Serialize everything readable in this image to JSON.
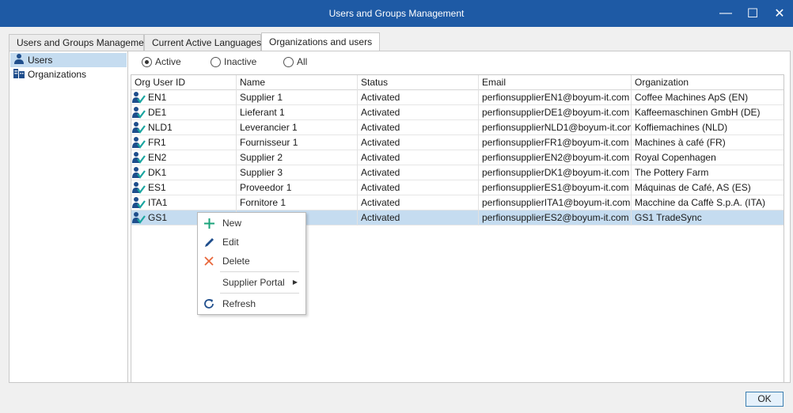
{
  "window": {
    "title": "Users and Groups Management",
    "controls": {
      "minimize": "—",
      "maximize": "☐",
      "close": "✕"
    }
  },
  "tabs": [
    {
      "label": "Users and Groups Management"
    },
    {
      "label": "Current Active Languages"
    },
    {
      "label": "Organizations and users",
      "active": true
    }
  ],
  "sidebar": {
    "items": [
      {
        "label": "Users",
        "icon": "users-icon",
        "selected": true
      },
      {
        "label": "Organizations",
        "icon": "organizations-icon"
      }
    ]
  },
  "filter": {
    "options": [
      {
        "label": "Active",
        "checked": true
      },
      {
        "label": "Inactive",
        "checked": false
      },
      {
        "label": "All",
        "checked": false
      }
    ]
  },
  "grid": {
    "columns": [
      "Org User ID",
      "Name",
      "Status",
      "Email",
      "Organization"
    ],
    "rows": [
      {
        "id": "EN1",
        "name": "Supplier 1",
        "status": "Activated",
        "email": "perfionsupplierEN1@boyum-it.com",
        "org": "Coffee Machines ApS (EN)"
      },
      {
        "id": "DE1",
        "name": "Lieferant 1",
        "status": "Activated",
        "email": "perfionsupplierDE1@boyum-it.com",
        "org": "Kaffeemaschinen GmbH (DE)"
      },
      {
        "id": "NLD1",
        "name": "Leverancier 1",
        "status": "Activated",
        "email": "perfionsupplierNLD1@boyum-it.com",
        "org": "Koffiemachines (NLD)"
      },
      {
        "id": "FR1",
        "name": "Fournisseur 1",
        "status": "Activated",
        "email": "perfionsupplierFR1@boyum-it.com",
        "org": "Machines à café (FR)"
      },
      {
        "id": "EN2",
        "name": "Supplier 2",
        "status": "Activated",
        "email": "perfionsupplierEN2@boyum-it.com",
        "org": "Royal Copenhagen"
      },
      {
        "id": "DK1",
        "name": "Supplier 3",
        "status": "Activated",
        "email": "perfionsupplierDK1@boyum-it.com",
        "org": "The Pottery Farm"
      },
      {
        "id": "ES1",
        "name": "Proveedor 1",
        "status": "Activated",
        "email": "perfionsupplierES1@boyum-it.com",
        "org": "Máquinas de Café, AS (ES)"
      },
      {
        "id": "ITA1",
        "name": "Fornitore 1",
        "status": "Activated",
        "email": "perfionsupplierITA1@boyum-it.com",
        "org": "Macchine da Caffè S.p.A. (ITA)"
      },
      {
        "id": "GS1",
        "name": "",
        "status": "Activated",
        "email": "perfionsupplierES2@boyum-it.com",
        "org": "GS1 TradeSync",
        "selected": true
      }
    ]
  },
  "context_menu": {
    "new": "New",
    "edit": "Edit",
    "delete": "Delete",
    "supplier_portal": "Supplier Portal",
    "refresh": "Refresh"
  },
  "footer": {
    "ok_label": "OK"
  },
  "colors": {
    "titlebar": "#1e5aa5",
    "selection": "#c5dcf0",
    "icon_blue": "#1f4e8c",
    "icon_teal": "#1aa6a0",
    "new_green": "#1aa37a",
    "delete_orange": "#e8663a"
  }
}
